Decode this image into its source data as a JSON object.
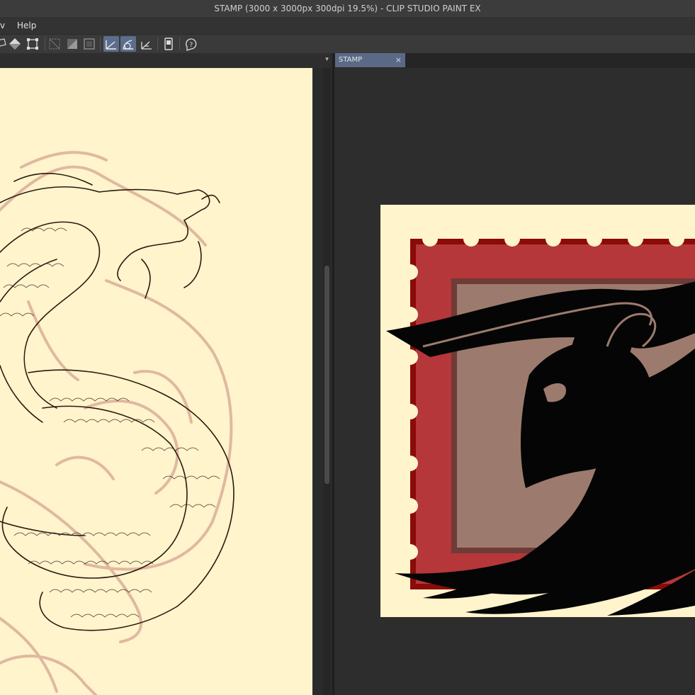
{
  "window": {
    "title": "STAMP (3000 x 3000px 300dpi 19.5%)  - CLIP STUDIO PAINT EX"
  },
  "menu": {
    "partial_item": "v",
    "help": "Help"
  },
  "toolbar": {
    "icons": [
      "lasso-icon",
      "fill-icon",
      "transform-icon",
      "clear-selection-icon",
      "invert-selection-icon",
      "selection-border-icon",
      "ruler-snap-icon",
      "special-ruler-snap-icon",
      "grid-snap-icon",
      "device-icon",
      "help-icon"
    ],
    "active": [
      "ruler-snap-icon",
      "special-ruler-snap-icon"
    ]
  },
  "tabs": [
    {
      "label": "STAMP",
      "close": "×"
    }
  ],
  "colors": {
    "canvas_paper": "#fff4cc",
    "stamp_red": "#b5373a",
    "stamp_border": "#8b0a0a",
    "stamp_inner": "#9c7b6e",
    "lineart": "#2b1a0e",
    "sketch": "#e0b8a0",
    "tab_active": "#5a6a86"
  }
}
